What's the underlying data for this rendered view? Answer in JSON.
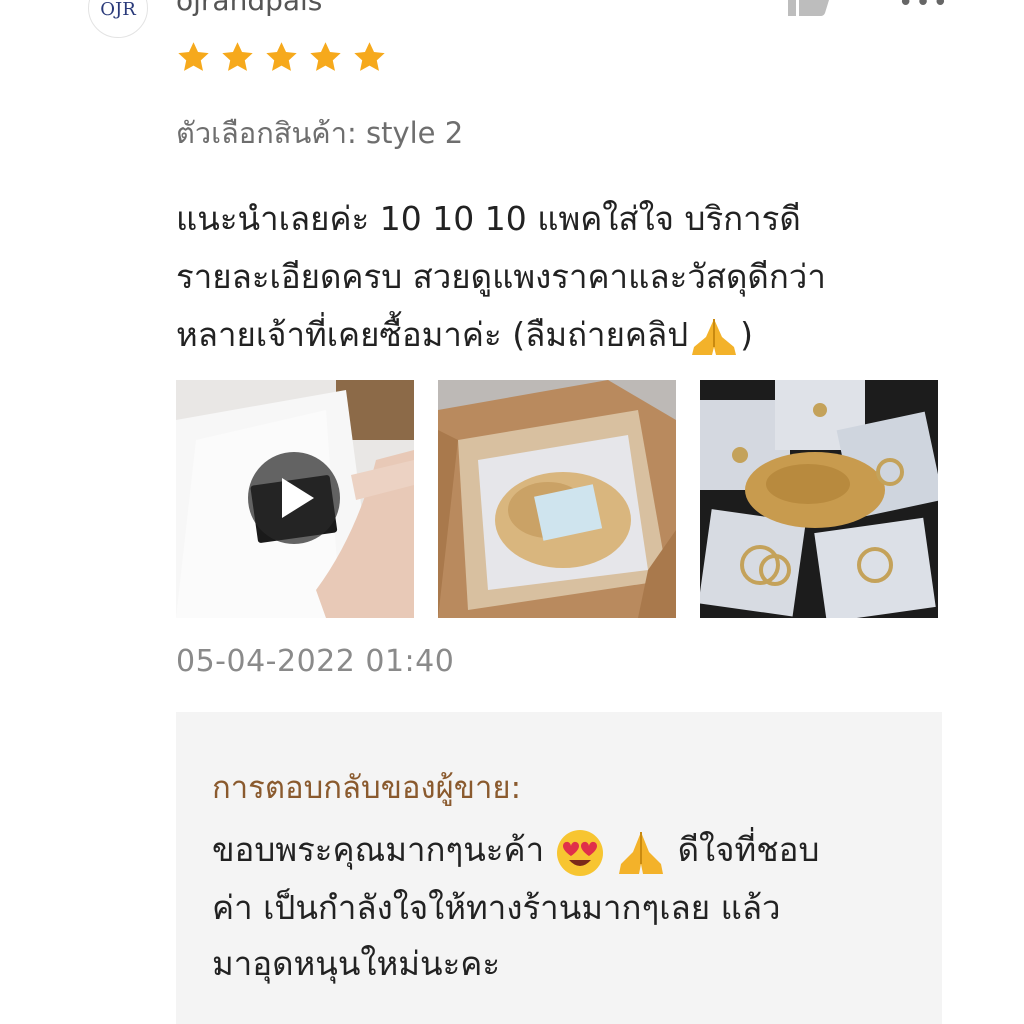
{
  "reviewer": {
    "avatar_logo_text": "OJR",
    "username": "ojrandpals"
  },
  "rating": {
    "stars": 5,
    "max": 5,
    "color": "#f6a91c"
  },
  "review": {
    "variation_label": "ตัวเลือกสินค้า:",
    "variation_value": "style 2",
    "text_lines": [
      "แนะนำเลยค่ะ 10 10 10 แพคใส่ใจ บริการดี",
      "รายละเอียดครบ สวยดูแพงราคาและวัสดุดีกว่า",
      "หลายเจ้าที่เคยซื้อมาค่ะ (ลืมถ่ายคลิป",
      ")"
    ],
    "media": [
      {
        "kind": "video",
        "icon": "play-icon",
        "description": "hand-holding-black-card"
      },
      {
        "kind": "image",
        "description": "box-with-scrunchie-and-note"
      },
      {
        "kind": "image",
        "description": "jewelry-packs-and-scrunchie"
      }
    ],
    "timestamp": "05-04-2022 01:40"
  },
  "seller_reply": {
    "label": "การตอบกลับของผู้ขาย:",
    "lines": [
      "ขอบพระคุณมากๆนะค้า",
      "ดีใจที่ชอบ",
      "ค่า เป็นกำลังใจให้ทางร้านมากๆเลย แล้ว",
      "มาอุดหนุนใหม่นะคะ"
    ]
  },
  "colors": {
    "star": "#f6a91c",
    "reply_label": "#8a5a2e",
    "reply_bg": "#f4f4f4",
    "muted_text": "#8a8a8a"
  }
}
